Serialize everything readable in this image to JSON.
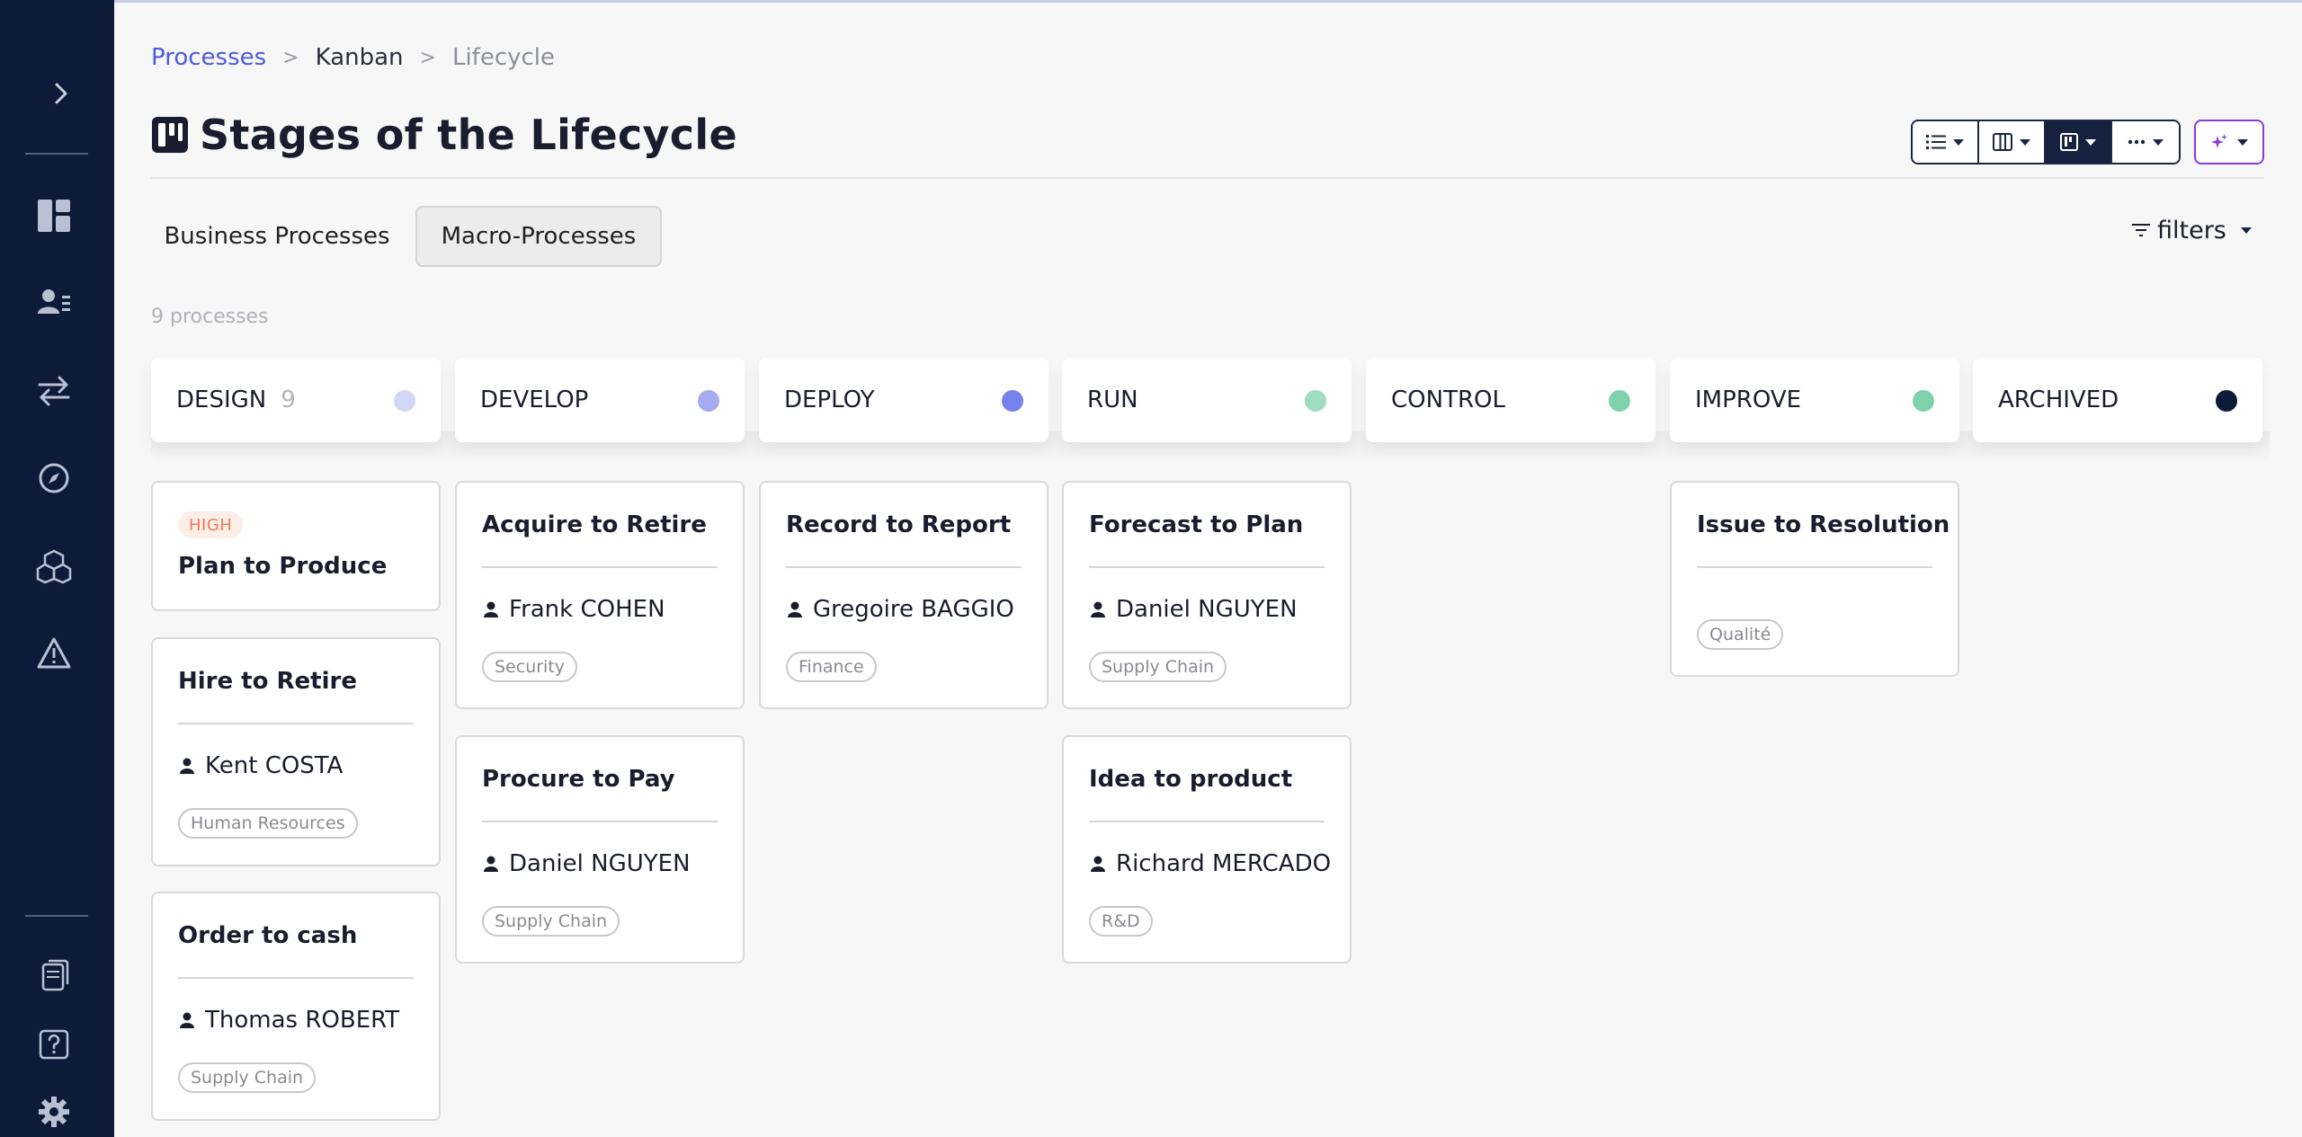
{
  "breadcrumb": {
    "root": "Processes",
    "middle": "Kanban",
    "current": "Lifecycle"
  },
  "page": {
    "title": "Stages of the Lifecycle",
    "title_icon": "kanban-board-icon"
  },
  "toolbar": {
    "views": [
      {
        "name": "list-view",
        "icon": "list-icon"
      },
      {
        "name": "columns-view",
        "icon": "columns-icon"
      },
      {
        "name": "kanban-view",
        "icon": "kanban-icon",
        "active": true
      },
      {
        "name": "more-view",
        "icon": "more-icon"
      }
    ],
    "ai_icon": "sparkles-icon",
    "filters_label": "filters"
  },
  "tabs": [
    {
      "label": "Business Processes",
      "active": false
    },
    {
      "label": "Macro-Processes",
      "active": true
    }
  ],
  "process_count": "9 processes",
  "colors": {
    "accent": "#4b5ae0",
    "sidebar": "#0d1a38",
    "priority_high": "#f07a55",
    "ai_border": "#8a3be0"
  },
  "columns": [
    {
      "label": "DESIGN",
      "count": "9",
      "dot_color": "#d3d7f6"
    },
    {
      "label": "DEVELOP",
      "count": "",
      "dot_color": "#a5acf2"
    },
    {
      "label": "DEPLOY",
      "count": "",
      "dot_color": "#7582ee"
    },
    {
      "label": "RUN",
      "count": "",
      "dot_color": "#9fdcc0"
    },
    {
      "label": "CONTROL",
      "count": "",
      "dot_color": "#7fd1ac"
    },
    {
      "label": "IMPROVE",
      "count": "",
      "dot_color": "#7fd1ac"
    },
    {
      "label": "ARCHIVED",
      "count": "",
      "dot_color": "#0d1a38"
    }
  ],
  "cards": {
    "design": [
      {
        "priority": "HIGH",
        "title": "Plan to Produce"
      },
      {
        "title": "Hire to Retire",
        "owner": "Kent COSTA",
        "tag": "Human Resources"
      },
      {
        "title": "Order to cash",
        "owner": "Thomas ROBERT",
        "tag": "Supply Chain"
      }
    ],
    "develop": [
      {
        "title": "Acquire to Retire",
        "owner": "Frank COHEN",
        "tag": "Security"
      },
      {
        "title": "Procure to Pay",
        "owner": "Daniel NGUYEN",
        "tag": "Supply Chain"
      }
    ],
    "deploy": [
      {
        "title": "Record to Report",
        "owner": "Gregoire BAGGIO",
        "tag": "Finance"
      }
    ],
    "run": [
      {
        "title": "Forecast to Plan",
        "owner": "Daniel NGUYEN",
        "tag": "Supply Chain"
      },
      {
        "title": "Idea to product",
        "owner": "Richard MERCADO",
        "tag": "R&D"
      }
    ],
    "improve": [
      {
        "title": "Issue to Resolution",
        "tag": "Qualité"
      }
    ]
  },
  "sidebar": {
    "icons": [
      "expand-chevron-icon",
      "dashboard-icon",
      "user-list-icon",
      "transfer-arrows-icon",
      "compass-icon",
      "cubes-icon",
      "warning-icon",
      "documents-icon",
      "help-icon",
      "settings-icon"
    ]
  }
}
